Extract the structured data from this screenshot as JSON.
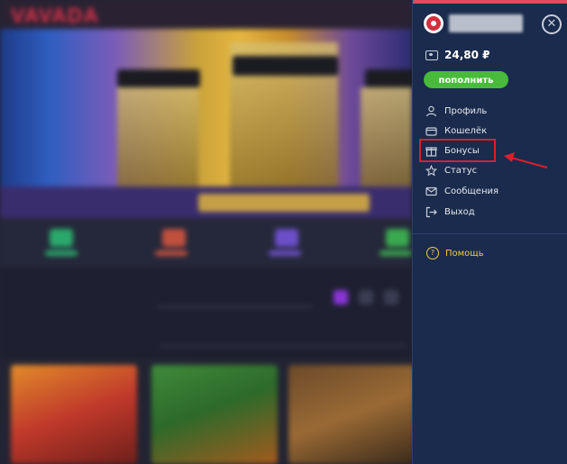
{
  "background_site": {
    "logo": "VAVADA"
  },
  "panel": {
    "balance": "24,80 ₽",
    "deposit_label": "пополнить",
    "close_icon": "close-icon",
    "menu": [
      {
        "label": "Профиль",
        "icon": "user-icon"
      },
      {
        "label": "Кошелёк",
        "icon": "wallet-icon"
      },
      {
        "label": "Бонусы",
        "icon": "gift-icon"
      },
      {
        "label": "Статус",
        "icon": "star-icon"
      },
      {
        "label": "Сообщения",
        "icon": "mail-icon"
      },
      {
        "label": "Выход",
        "icon": "logout-icon"
      }
    ],
    "help_label": "Помощь"
  },
  "colors": {
    "panel_bg": "#1a2b4d",
    "accent_green": "#49ba3b",
    "help_yellow": "#f2c94c",
    "annotation_red": "#d8202c"
  }
}
